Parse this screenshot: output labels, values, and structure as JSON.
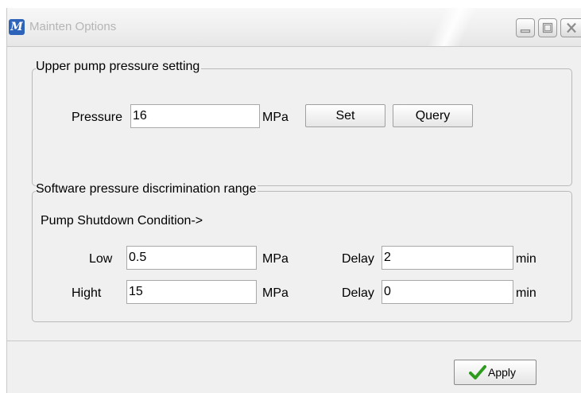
{
  "window": {
    "title": "Mainten Options",
    "icon": "mainten-app-icon",
    "app_icon_glyph": "M"
  },
  "upper_pump": {
    "legend": "Upper pump pressure setting",
    "pressure_label": "Pressure",
    "pressure_value": "16",
    "pressure_unit": "MPa",
    "set_label": "Set",
    "query_label": "Query"
  },
  "discrimination": {
    "legend": "Software pressure discrimination range",
    "shutdown_condition": "Pump Shutdown Condition->",
    "low": {
      "label": "Low",
      "value": "0.5",
      "unit": "MPa",
      "delay_label": "Delay",
      "delay_value": "2",
      "delay_unit": "min"
    },
    "high": {
      "label": "Hight",
      "value": "15",
      "unit": "MPa",
      "delay_label": "Delay",
      "delay_value": "0",
      "delay_unit": "min"
    }
  },
  "footer": {
    "apply_label": "Apply",
    "apply_icon": "green-check-icon",
    "check_color": "#2e9b1f"
  }
}
